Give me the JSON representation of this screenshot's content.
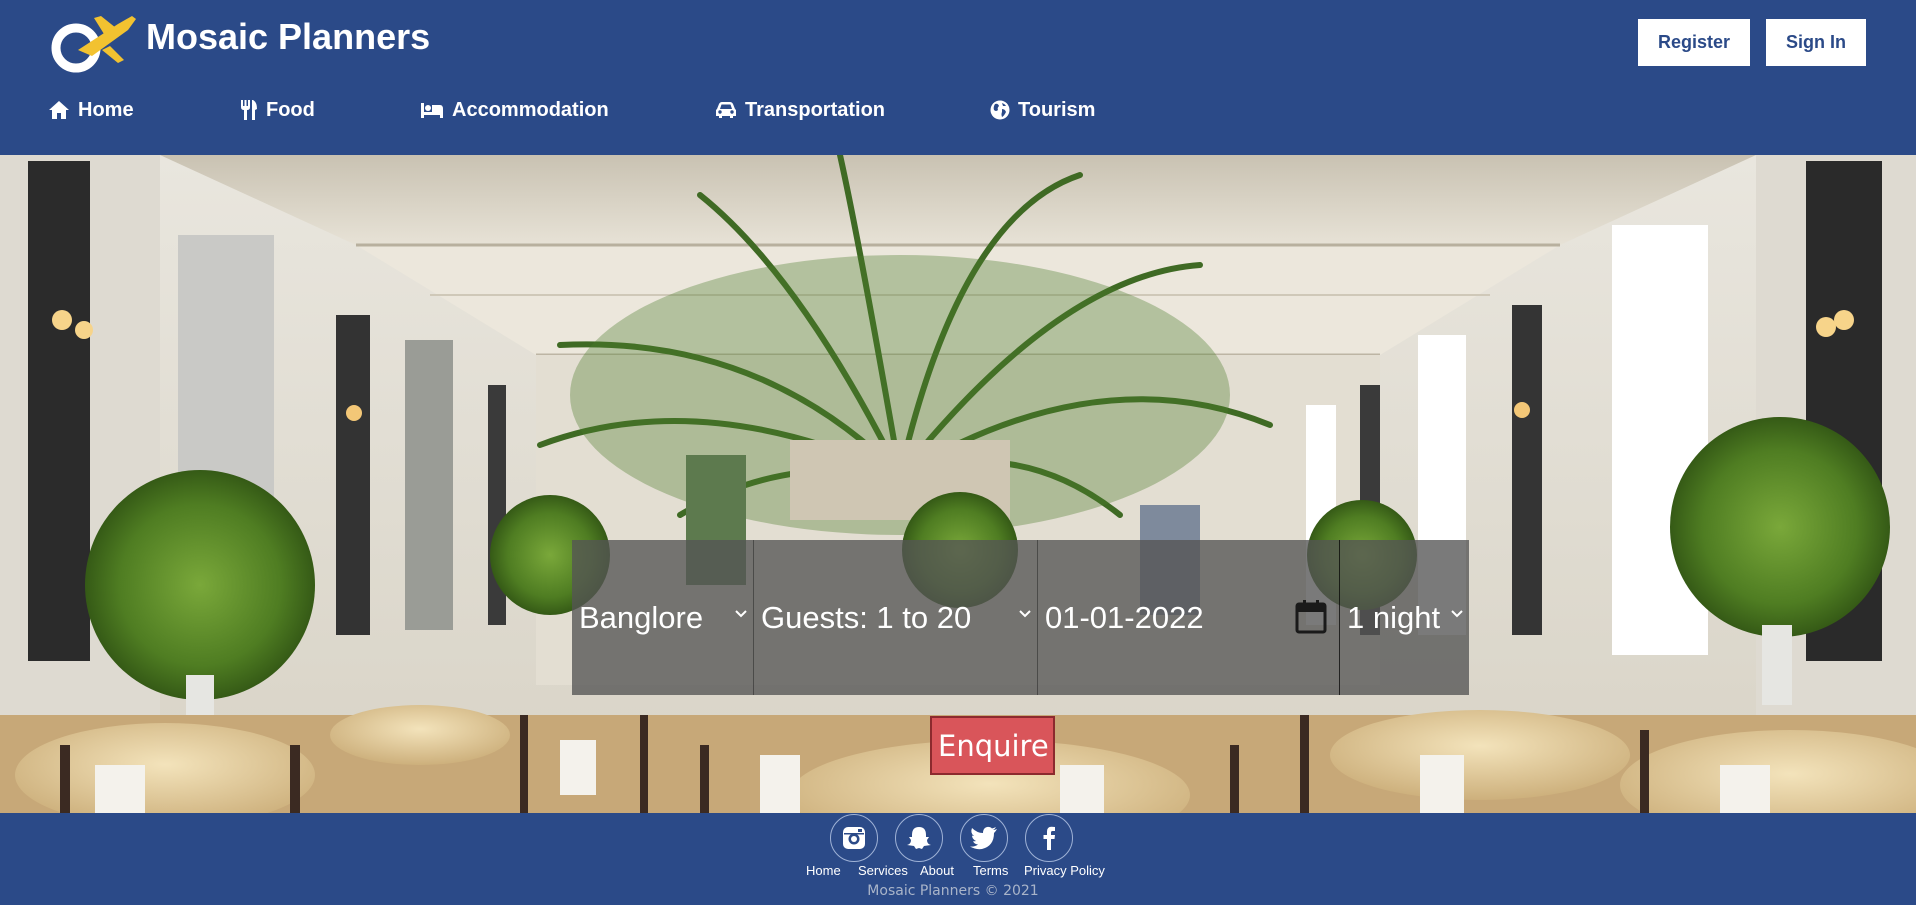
{
  "header": {
    "brand": "Mosaic Planners",
    "register_label": "Register",
    "signin_label": "Sign In"
  },
  "nav": {
    "items": [
      {
        "label": "Home",
        "icon": "home-icon"
      },
      {
        "label": "Food",
        "icon": "utensils-icon"
      },
      {
        "label": "Accommodation",
        "icon": "bed-icon"
      },
      {
        "label": "Transportation",
        "icon": "car-icon"
      },
      {
        "label": "Tourism",
        "icon": "globe-icon"
      }
    ]
  },
  "search": {
    "city": "Banglore",
    "guests": "Guests: 1 to 20",
    "date": "01-01-2022",
    "nights": "1 night",
    "enquire_label": "Enquire"
  },
  "footer": {
    "social": [
      "instagram-icon",
      "snapchat-icon",
      "twitter-icon",
      "facebook-icon"
    ],
    "links": [
      "Home",
      "Services",
      "About",
      "Terms",
      "Privacy Policy"
    ],
    "copyright": "Mosaic Planners © 2021"
  },
  "colors": {
    "brand_blue": "#2b4a88",
    "enquire_red": "#d9555a",
    "logo_yellow": "#f2c230"
  }
}
